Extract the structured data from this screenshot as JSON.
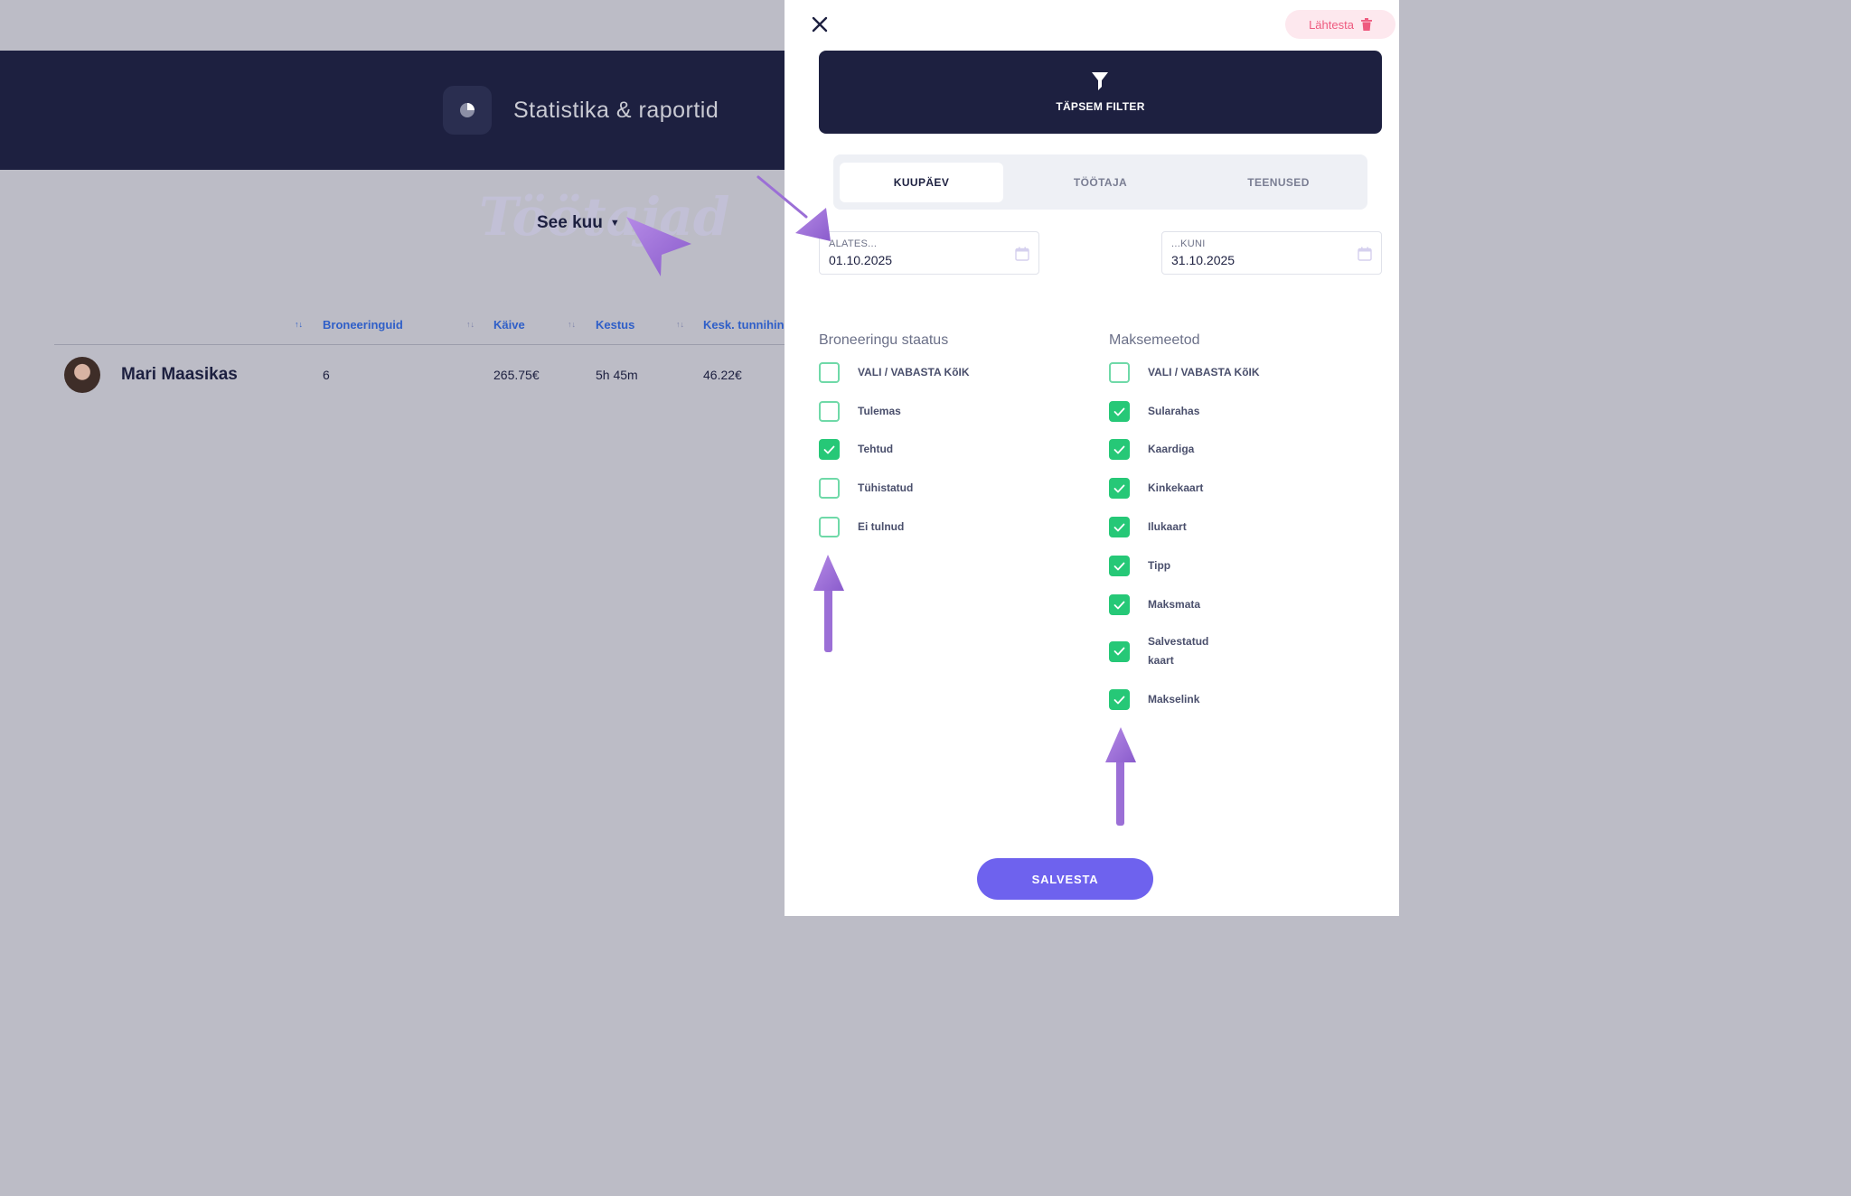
{
  "app": {
    "title": "Statistika & raportid",
    "watermark": "Töötajad",
    "period": "See kuu"
  },
  "table": {
    "columns": [
      "Broneeringuid",
      "Käive",
      "Kestus",
      "Kesk. tunnihin"
    ],
    "rows": [
      {
        "name": "Mari Maasikas",
        "bookings": "6",
        "turnover": "265.75€",
        "duration": "5h 45m",
        "avg_rate": "46.22€"
      }
    ]
  },
  "panel": {
    "reset_label": "Lähtesta",
    "filter_title": "TÄPSEM FILTER",
    "tabs": [
      {
        "label": "KUUPÄEV",
        "active": true
      },
      {
        "label": "TÖÖTAJA",
        "active": false
      },
      {
        "label": "TEENUSED",
        "active": false
      }
    ],
    "date_from": {
      "label": "ALATES...",
      "value": "01.10.2025"
    },
    "date_to": {
      "label": "...KUNI",
      "value": "31.10.2025"
    },
    "status": {
      "title": "Broneeringu staatus",
      "items": [
        {
          "label": "VALI / VABASTA KõIK",
          "checked": false
        },
        {
          "label": "Tulemas",
          "checked": false
        },
        {
          "label": "Tehtud",
          "checked": true
        },
        {
          "label": "Tühistatud",
          "checked": false
        },
        {
          "label": "Ei tulnud",
          "checked": false
        }
      ]
    },
    "payment": {
      "title": "Maksemeetod",
      "items": [
        {
          "label": "VALI / VABASTA KõIK",
          "checked": false
        },
        {
          "label": "Sularahas",
          "checked": true
        },
        {
          "label": "Kaardiga",
          "checked": true
        },
        {
          "label": "Kinkekaart",
          "checked": true
        },
        {
          "label": "Ilukaart",
          "checked": true
        },
        {
          "label": "Tipp",
          "checked": true
        },
        {
          "label": "Maksmata",
          "checked": true
        },
        {
          "label": "Salvestatud kaart",
          "checked": true
        },
        {
          "label": "Makselink",
          "checked": true
        }
      ]
    },
    "save_label": "SALVESTA"
  },
  "colors": {
    "navy": "#1d2040",
    "accent_purple": "#6e62ee",
    "check_green": "#26c877",
    "reset_pink": "#ee5a7f",
    "annotation_arrow": "#9b6fd6"
  },
  "icons": [
    "pie-chart-icon",
    "close-icon",
    "trash-icon",
    "funnel-icon",
    "calendar-icon",
    "check-icon",
    "sort-icon",
    "caret-down-icon"
  ]
}
